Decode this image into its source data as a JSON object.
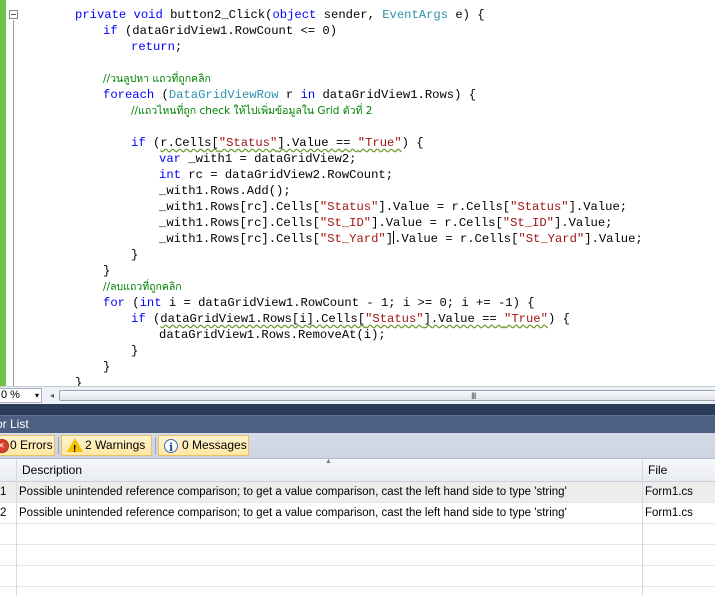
{
  "editor": {
    "code_lines": [
      [
        [
          "kw",
          "private void "
        ],
        [
          "t",
          "button2_Click("
        ],
        [
          "kw",
          "object "
        ],
        [
          "t",
          "sender, "
        ],
        [
          "ty",
          "EventArgs "
        ],
        [
          "t",
          "e) {"
        ]
      ],
      [
        [
          "kw",
          "if "
        ],
        [
          "t",
          "(dataGridView1.RowCount <= 0)"
        ]
      ],
      [
        [
          "kw",
          "return"
        ],
        [
          "t",
          ";"
        ]
      ],
      [],
      [
        [
          "cm",
          "//วนลูปหา แถวที่ถูกคลิก"
        ]
      ],
      [
        [
          "kw",
          "foreach "
        ],
        [
          "t",
          "("
        ],
        [
          "ty",
          "DataGridViewRow "
        ],
        [
          "t",
          "r "
        ],
        [
          "kw",
          "in "
        ],
        [
          "t",
          "dataGridView1.Rows) {"
        ]
      ],
      [
        [
          "cm",
          "//แถวไหนที่ถูก check ให้ไปเพิ่มข้อมูลใน Grid ตัวที่ 2"
        ]
      ],
      [],
      [
        [
          "kw",
          "if "
        ],
        [
          "t",
          "("
        ],
        [
          "sq",
          "r.Cells["
        ],
        [
          "sqs",
          "\"Status\""
        ],
        [
          "sq",
          "].Value == "
        ],
        [
          "sqs",
          "\"True\""
        ],
        [
          "t",
          ") {"
        ]
      ],
      [
        [
          "kw",
          "var "
        ],
        [
          "t",
          "_with1 = dataGridView2;"
        ]
      ],
      [
        [
          "kw",
          "int "
        ],
        [
          "t",
          "rc = dataGridView2.RowCount;"
        ]
      ],
      [
        [
          "t",
          "_with1.Rows.Add();"
        ]
      ],
      [
        [
          "t",
          "_with1.Rows[rc].Cells["
        ],
        [
          "st",
          "\"Status\""
        ],
        [
          "t",
          "].Value = r.Cells["
        ],
        [
          "st",
          "\"Status\""
        ],
        [
          "t",
          "].Value;"
        ]
      ],
      [
        [
          "t",
          "_with1.Rows[rc].Cells["
        ],
        [
          "st",
          "\"St_ID\""
        ],
        [
          "t",
          "].Value = r.Cells["
        ],
        [
          "st",
          "\"St_ID\""
        ],
        [
          "t",
          "].Value;"
        ]
      ],
      [
        [
          "t",
          "_with1.Rows[rc].Cells["
        ],
        [
          "st",
          "\"St_Yard\""
        ],
        [
          "t",
          "]"
        ],
        [
          "caret",
          ""
        ],
        [
          "t",
          ".Value = r.Cells["
        ],
        [
          "st",
          "\"St_Yard\""
        ],
        [
          "t",
          "].Value;"
        ]
      ],
      [
        [
          "t",
          "}"
        ]
      ],
      [
        [
          "t",
          "}"
        ]
      ],
      [
        [
          "cm",
          "//ลบแถวที่ถูกคลิก"
        ]
      ],
      [
        [
          "kw",
          "for "
        ],
        [
          "t",
          "("
        ],
        [
          "kw",
          "int "
        ],
        [
          "t",
          "i = dataGridView1.RowCount - 1; i >= 0; i += -1) {"
        ]
      ],
      [
        [
          "kw",
          "if "
        ],
        [
          "t",
          "("
        ],
        [
          "sq",
          "dataGridView1.Rows[i].Cells["
        ],
        [
          "sqs",
          "\"Status\""
        ],
        [
          "sq",
          "].Value == "
        ],
        [
          "sqs",
          "\"True\""
        ],
        [
          "t",
          ") {"
        ]
      ],
      [
        [
          "t",
          "dataGridView1.Rows.RemoveAt(i);"
        ]
      ],
      [
        [
          "t",
          "}"
        ]
      ],
      [
        [
          "t",
          "}"
        ]
      ],
      [
        [
          "t",
          "}"
        ]
      ]
    ]
  },
  "zoom": {
    "value": "0 %",
    "arrow": "▾"
  },
  "scrollbar": {
    "left_arrow": "◂",
    "grip": "III"
  },
  "panel": {
    "title": "or List",
    "filters": {
      "errors": "0 Errors",
      "warnings": "2 Warnings",
      "messages": "0 Messages"
    },
    "columns": {
      "sort_glyph": "▲",
      "description": "Description",
      "file": "File"
    },
    "rows": [
      {
        "num": "1",
        "description": "Possible unintended reference comparison; to get a value comparison, cast the left hand side to type 'string'",
        "file": "Form1.cs"
      },
      {
        "num": "2",
        "description": "Possible unintended reference comparison; to get a value comparison, cast the left hand side to type 'string'",
        "file": "Form1.cs"
      }
    ]
  }
}
